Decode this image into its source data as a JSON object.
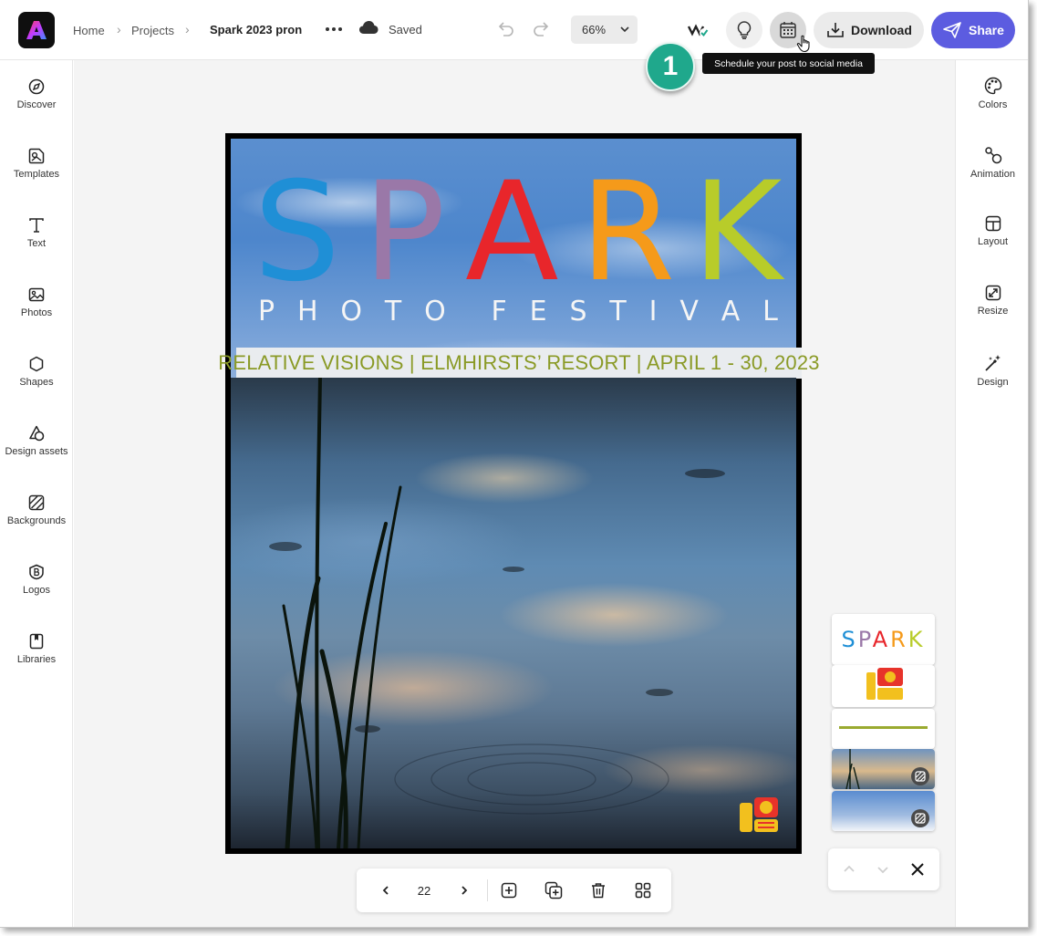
{
  "app": {
    "breadcrumb": [
      "Home",
      "Projects"
    ],
    "document_title": "Spark 2023 pron",
    "save_status": "Saved",
    "zoom": "66%",
    "download_label": "Download",
    "share_label": "Share",
    "tooltip": "Schedule your post to social media",
    "step_badge": "1",
    "accent_color": "#5c5ce0",
    "badge_color": "#1fa88c"
  },
  "left_rail": [
    {
      "label": "Discover",
      "icon": "compass-icon"
    },
    {
      "label": "Templates",
      "icon": "templates-icon"
    },
    {
      "label": "Text",
      "icon": "text-icon"
    },
    {
      "label": "Photos",
      "icon": "photo-icon"
    },
    {
      "label": "Shapes",
      "icon": "shapes-icon"
    },
    {
      "label": "Design assets",
      "icon": "design-assets-icon"
    },
    {
      "label": "Backgrounds",
      "icon": "backgrounds-icon"
    },
    {
      "label": "Logos",
      "icon": "logos-icon"
    },
    {
      "label": "Libraries",
      "icon": "libraries-icon"
    }
  ],
  "right_rail": [
    {
      "label": "Colors",
      "icon": "palette-icon"
    },
    {
      "label": "Animation",
      "icon": "animation-icon"
    },
    {
      "label": "Layout",
      "icon": "layout-icon"
    },
    {
      "label": "Resize",
      "icon": "resize-icon"
    },
    {
      "label": "Design",
      "icon": "magic-wand-icon"
    }
  ],
  "poster": {
    "letters": [
      {
        "char": "S",
        "color": "#1f8fd6"
      },
      {
        "char": "P",
        "color": "#9a78a8"
      },
      {
        "char": "A",
        "color": "#e8262b"
      },
      {
        "char": "R",
        "color": "#f59a1a"
      },
      {
        "char": "K",
        "color": "#b8cc2a"
      }
    ],
    "festival_letters": [
      "P",
      "H",
      "O",
      "T",
      "O",
      " ",
      "F",
      "E",
      "S",
      "T",
      "I",
      "V",
      "A",
      "L"
    ],
    "subtitle": "RELATIVE VISIONS | ELMHIRSTS’ RESORT | APRIL 1 - 30, 2023"
  },
  "page_nav": {
    "current_page": "22"
  },
  "thumbnails": [
    {
      "type": "spark-title",
      "text": "SPARK"
    },
    {
      "type": "logo"
    },
    {
      "type": "subtitle"
    },
    {
      "type": "photo-reeds"
    },
    {
      "type": "photo-sky"
    }
  ]
}
